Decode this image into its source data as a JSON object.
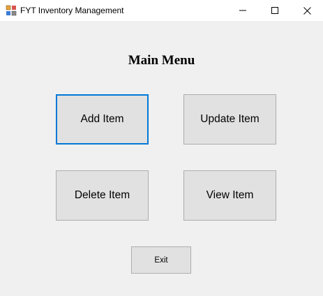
{
  "window": {
    "title": "FYT Inventory Management",
    "accent_color": "#0078d7",
    "button_face_color": "#e1e1e1",
    "button_border_color": "#adadad",
    "background_color": "#f0f0f0"
  },
  "icons": {
    "app": "app-grid-icon",
    "minimize": "minimize-icon",
    "maximize": "maximize-icon",
    "close": "close-icon"
  },
  "main": {
    "heading": "Main Menu",
    "buttons": {
      "add": "Add Item",
      "update": "Update Item",
      "delete": "Delete Item",
      "view": "View Item",
      "exit": "Exit"
    },
    "focused_button": "add"
  }
}
